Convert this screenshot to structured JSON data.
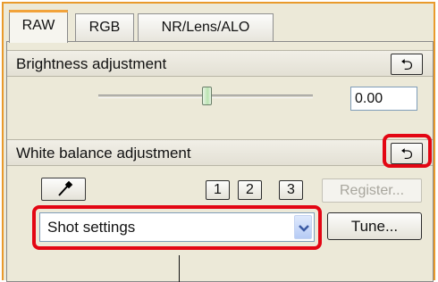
{
  "tabs": [
    {
      "label": "RAW",
      "active": true
    },
    {
      "label": "RGB",
      "active": false
    },
    {
      "label": "NR/Lens/ALO",
      "active": false
    }
  ],
  "brightness": {
    "title": "Brightness adjustment",
    "value": "0.00",
    "slider_level": 0.5,
    "reset_icon": "undo-arrow-icon"
  },
  "white_balance": {
    "title": "White balance adjustment",
    "reset_icon": "undo-arrow-icon",
    "picker_icon": "eyedropper-icon",
    "presets": [
      "1",
      "2",
      "3"
    ],
    "register_label": "Register...",
    "selected": "Shot settings",
    "tune_label": "Tune..."
  },
  "colors": {
    "tab_accent": "#f2a33a",
    "frame": "#e99a2c",
    "highlight": "#e30613",
    "panel_bg": "#ece9d8"
  }
}
